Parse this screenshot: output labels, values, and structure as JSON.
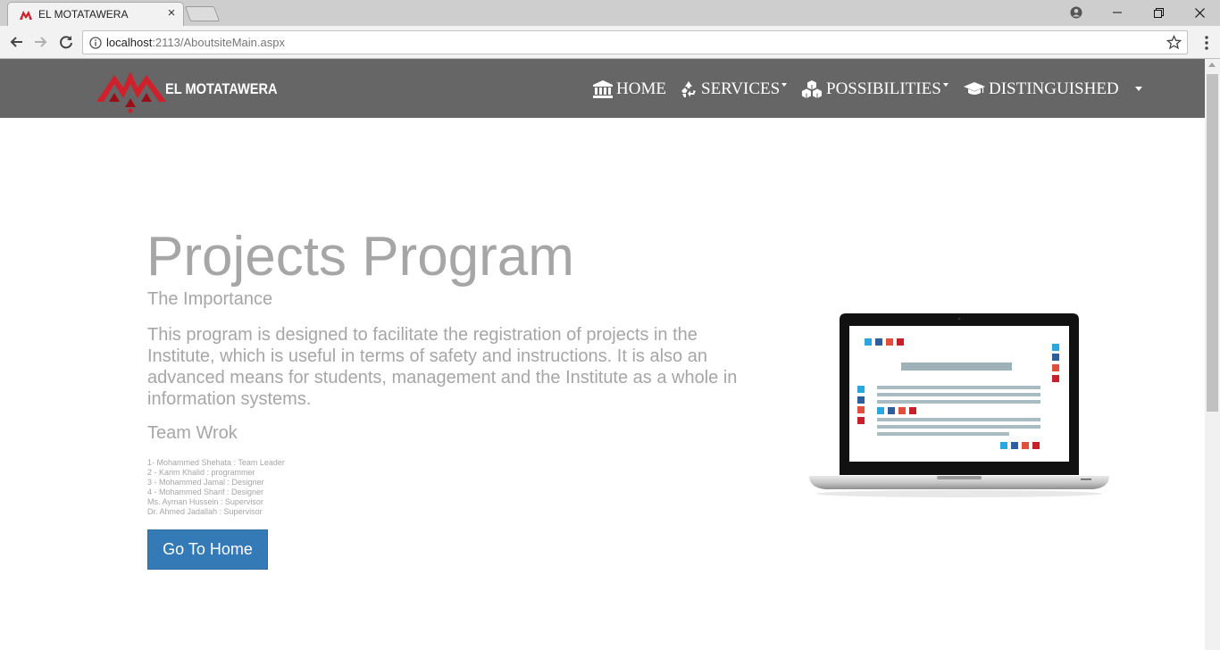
{
  "browser": {
    "tab_title": "EL MOTATAWERA",
    "tab_close": "×",
    "url_host": "localhost",
    "url_rest": ":2113/AboutsiteMain.aspx"
  },
  "site": {
    "brand": "EL MOTATAWERA",
    "brand_color": "#d0202c",
    "nav_bg": "#666666",
    "nav": [
      {
        "label": "HOME",
        "icon": "bank-icon",
        "dropdown": false
      },
      {
        "label": "SERVICES",
        "icon": "recycle-icon",
        "dropdown": true
      },
      {
        "label": "POSSIBILITIES",
        "icon": "cubes-icon",
        "dropdown": true
      },
      {
        "label": "DISTINGUISHED",
        "icon": "graduation-cap-icon",
        "dropdown": false
      }
    ]
  },
  "main": {
    "title": "Projects Program",
    "subtitle": "The Importance",
    "description": "This program is designed to facilitate the registration of projects in the Institute, which is useful in terms of safety and instructions. It is also an advanced means for students, management and the Institute as a whole in information systems.",
    "team_heading": "Team Wrok",
    "team": [
      "1- Mohammed Shehata : Team Leader",
      "2 - Karim Khalid : programmer",
      "3 - Mohammed Jamal : Designer",
      "4 - Mohammed Sharif : Designer",
      "Ms. Ayman Hussein : Supervisor",
      "Dr. Ahmed Jadallah : Supervisor"
    ],
    "button_label": "Go To Home",
    "button_color": "#337ab7",
    "text_color": "#a6a6a6"
  }
}
